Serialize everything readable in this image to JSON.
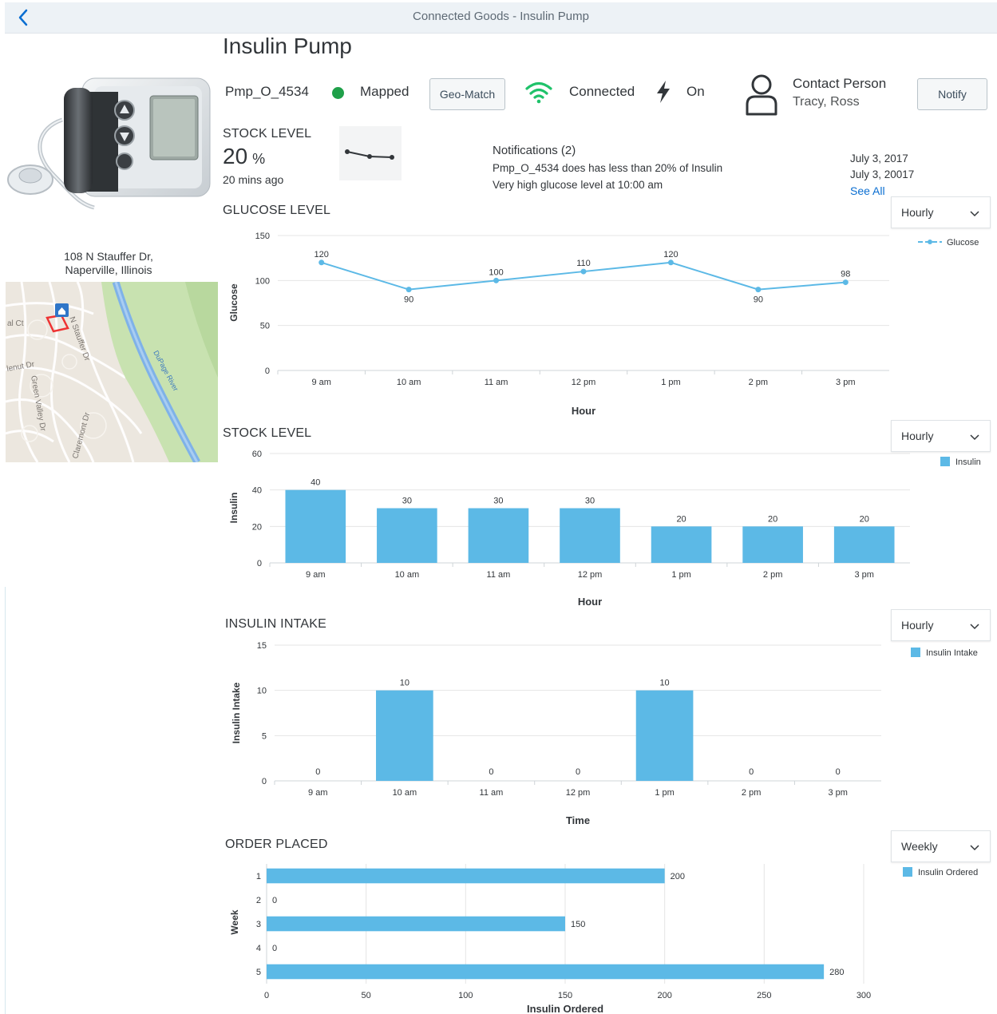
{
  "header": {
    "title": "Connected Goods - Insulin Pump"
  },
  "page": {
    "title": "Insulin Pump"
  },
  "device": {
    "id": "Pmp_O_4534",
    "mapped_status": "Mapped",
    "geo_match_label": "Geo-Match",
    "connection_status": "Connected",
    "power_status": "On",
    "contact_label": "Contact Person",
    "contact_name": "Tracy, Ross",
    "notify_label": "Notify",
    "status_color": "#1fa04a",
    "wifi_color": "#1fc26a",
    "image_alt": "insulin pump device"
  },
  "address": {
    "line1": "108 N Stauffer Dr,",
    "line2": "Naperville, Illinois"
  },
  "map": {
    "labels": [
      "al Ct",
      "N Stauffer Dr",
      "lenut Dr",
      "Green Valley Dr",
      "Claremont Dr",
      "DuPage River"
    ]
  },
  "stock_summary": {
    "label": "STOCK LEVEL",
    "value": "20",
    "unit": "%",
    "updated": "20 mins ago"
  },
  "notifications": {
    "title": "Notifications (2)",
    "items": [
      {
        "text": "Pmp_O_4534 does has less than 20% of Insulin",
        "date": "July 3, 2017"
      },
      {
        "text": "Very high glucose level at 10:00 am",
        "date": "July 3, 20017"
      }
    ],
    "see_all_label": "See All"
  },
  "sections": {
    "glucose": {
      "label": "GLUCOSE LEVEL",
      "dropdown": "Hourly"
    },
    "stock": {
      "label": "STOCK LEVEL",
      "dropdown": "Hourly"
    },
    "intake": {
      "label": "INSULIN INTAKE",
      "dropdown": "Hourly"
    },
    "orders": {
      "label": "ORDER PLACED",
      "dropdown": "Weekly"
    }
  },
  "colors": {
    "bar": "#5cb9e6",
    "line": "#5cb9e6",
    "grid": "#e5e5e5",
    "axis": "#cfd4d8"
  },
  "chart_data": [
    {
      "id": "glucose",
      "type": "line",
      "categories": [
        "9 am",
        "10 am",
        "11 am",
        "12 pm",
        "1 pm",
        "2 pm",
        "3 pm"
      ],
      "series": [
        {
          "name": "Glucose",
          "values": [
            120,
            90,
            100,
            110,
            120,
            90,
            98
          ]
        }
      ],
      "ticks": [
        0,
        50,
        100,
        150
      ],
      "ylim": [
        0,
        150
      ],
      "xlabel": "Hour",
      "ylabel": "Glucose",
      "legend_placement": "top-right",
      "grid": true
    },
    {
      "id": "stock",
      "type": "bar",
      "categories": [
        "9 am",
        "10 am",
        "11 am",
        "12 pm",
        "1 pm",
        "2 pm",
        "3 pm"
      ],
      "series": [
        {
          "name": "Insulin",
          "values": [
            40,
            30,
            30,
            30,
            20,
            20,
            20
          ]
        }
      ],
      "ticks": [
        0,
        20,
        40,
        60
      ],
      "ylim": [
        0,
        60
      ],
      "xlabel": "Hour",
      "ylabel": "Insulin",
      "legend_placement": "top-right",
      "grid": true
    },
    {
      "id": "intake",
      "type": "bar",
      "categories": [
        "9 am",
        "10 am",
        "11 am",
        "12 pm",
        "1 pm",
        "2 pm",
        "3 pm"
      ],
      "series": [
        {
          "name": "Insulin Intake",
          "values": [
            0,
            10,
            0,
            0,
            10,
            0,
            0
          ]
        }
      ],
      "ticks": [
        0,
        5,
        10,
        15
      ],
      "ylim": [
        0,
        15
      ],
      "xlabel": "Time",
      "ylabel": "Insulin Intake",
      "legend_placement": "top-right",
      "grid": true
    },
    {
      "id": "orders",
      "type": "bar",
      "orientation": "horizontal",
      "categories": [
        "1",
        "2",
        "3",
        "4",
        "5"
      ],
      "series": [
        {
          "name": "Insulin Ordered",
          "values": [
            200,
            0,
            150,
            0,
            280
          ]
        }
      ],
      "ticks": [
        0,
        50,
        100,
        150,
        200,
        250,
        300
      ],
      "xlim": [
        0,
        300
      ],
      "xlabel": "Insulin Ordered",
      "ylabel": "Week",
      "legend_placement": "top-right",
      "grid": true
    }
  ]
}
